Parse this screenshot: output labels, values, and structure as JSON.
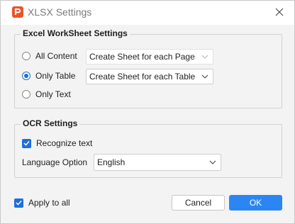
{
  "window": {
    "title": "XLSX Settings"
  },
  "excel_group": {
    "title": "Excel WorkSheet Settings",
    "options": [
      {
        "label": "All Content",
        "checked": false,
        "dropdown": "Create Sheet for each Page",
        "enabled": false
      },
      {
        "label": "Only Table",
        "checked": true,
        "dropdown": "Create Sheet for each Table",
        "enabled": true
      },
      {
        "label": "Only Text",
        "checked": false
      }
    ]
  },
  "ocr_group": {
    "title": "OCR Settings",
    "recognize_label": "Recognize text",
    "recognize_checked": true,
    "language_label": "Language Option",
    "language_value": "English"
  },
  "footer": {
    "apply_all_label": "Apply to all",
    "apply_all_checked": true,
    "cancel_label": "Cancel",
    "ok_label": "OK"
  },
  "colors": {
    "accent": "#1e6fdc",
    "ok_button": "#2b86f3",
    "app_icon": "#e8542d"
  },
  "icons": {
    "app": "pdf-app-icon",
    "close": "close-icon",
    "dropdown": "chevron-down-icon",
    "check": "checkmark-icon"
  }
}
